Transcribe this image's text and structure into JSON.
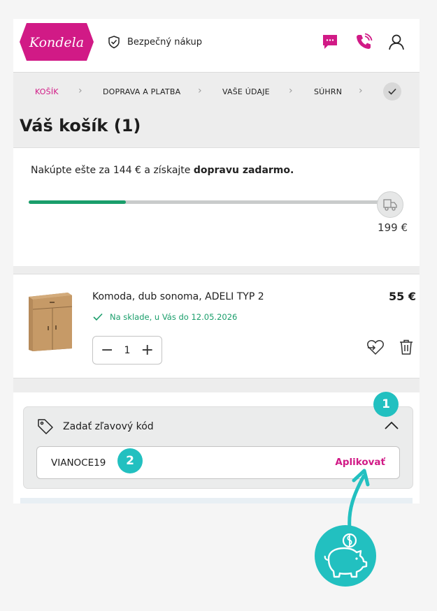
{
  "header": {
    "logo_text": "Kondela",
    "secure_label": "Bezpečný nákup"
  },
  "steps": [
    {
      "label": "KOŠÍK",
      "active": true
    },
    {
      "label": "DOPRAVA A PLATBA",
      "active": false
    },
    {
      "label": "VAŠE ÚDAJE",
      "active": false
    },
    {
      "label": "SÚHRN",
      "active": false
    }
  ],
  "cart": {
    "title": "Váš košík (1)"
  },
  "free_delivery": {
    "text_prefix": "Nakúpte ešte za 144 € a získajte ",
    "text_bold": "dopravu zadarmo.",
    "progress": 0.275,
    "threshold": "199 €"
  },
  "product": {
    "name": "Komoda, dub sonoma, ADELI TYP 2",
    "price": "55 €",
    "stock": "Na sklade, u Vás do 12.05.2026",
    "quantity": "1",
    "minus": "−",
    "plus": "+"
  },
  "discount": {
    "label": "Zadať zľavový kód",
    "code_value": "VIANOCE19",
    "apply_label": "Aplikovať"
  },
  "annotations": {
    "badge_1": "1",
    "badge_2": "2"
  },
  "colors": {
    "brand": "#d11a86",
    "success": "#1a9e6b",
    "annotation": "#22c0c0"
  }
}
